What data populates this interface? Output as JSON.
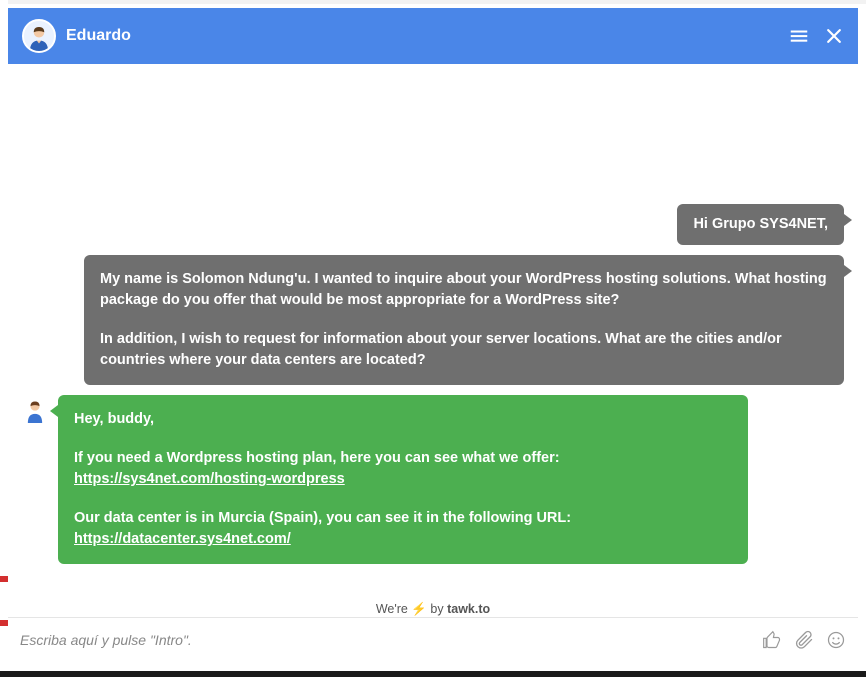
{
  "header": {
    "operator_name": "Eduardo"
  },
  "messages": {
    "m1": {
      "text": "Hi Grupo SYS4NET,"
    },
    "m2": {
      "p1": "My name is Solomon Ndung'u. I wanted to inquire about your WordPress hosting solutions. What hosting package do you offer that would be most appropriate for a WordPress site?",
      "p2": "In addition, I wish to request for information about your server locations. What are the cities and/or countries where your data centers are located?"
    },
    "m3": {
      "p1": "Hey, buddy,",
      "p2_pre": "If you need a Wordpress hosting plan, here you can see what we offer: ",
      "p2_link": "https://sys4net.com/hosting-wordpress",
      "p3_pre": "Our data center is in Murcia (Spain), you can see it in the following URL: ",
      "p3_link": "https://datacenter.sys4net.com/"
    }
  },
  "attribution": {
    "pre": "We're ",
    "post": " by ",
    "brand": "tawk.to"
  },
  "input": {
    "placeholder": "Escriba aquí y pulse \"Intro\"."
  }
}
